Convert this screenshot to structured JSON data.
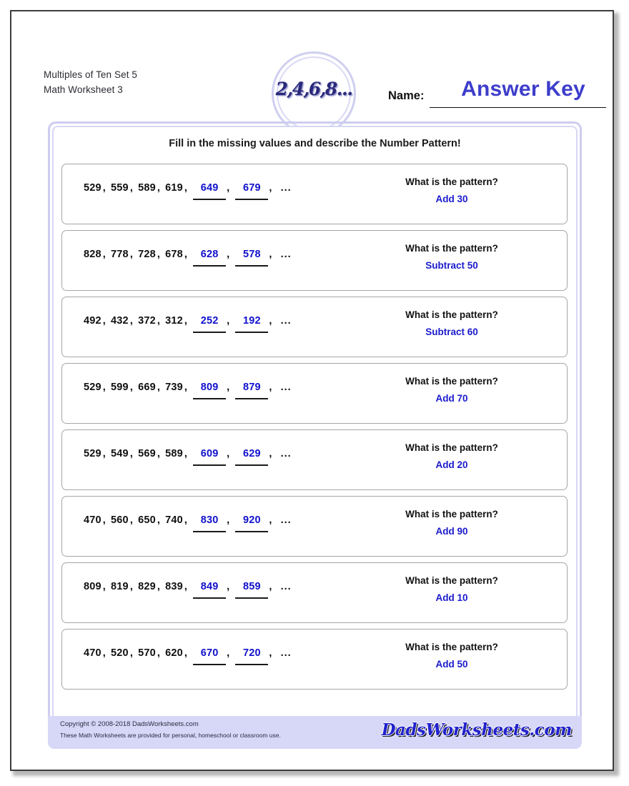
{
  "header": {
    "title_line1": "Multiples of Ten Set 5",
    "title_line2": "Math Worksheet 3",
    "logo_text": "2,4,6,8...",
    "name_label": "Name:",
    "answer_key": "Answer Key"
  },
  "instructions": "Fill in the missing values and describe the Number Pattern!",
  "question_label": "What is the pattern?",
  "ellipsis": "...",
  "colors": {
    "answer_blue": "#1111cc",
    "answer_key_blue": "#3d3dcc",
    "frame_lavender": "#cdcdf0",
    "footer_bg": "#d7d7f7",
    "box_border": "#a6a6a6"
  },
  "problems": [
    {
      "given": [
        "529",
        "559",
        "589",
        "619"
      ],
      "blanks": [
        "649",
        "679"
      ],
      "pattern": "Add 30"
    },
    {
      "given": [
        "828",
        "778",
        "728",
        "678"
      ],
      "blanks": [
        "628",
        "578"
      ],
      "pattern": "Subtract 50"
    },
    {
      "given": [
        "492",
        "432",
        "372",
        "312"
      ],
      "blanks": [
        "252",
        "192"
      ],
      "pattern": "Subtract 60"
    },
    {
      "given": [
        "529",
        "599",
        "669",
        "739"
      ],
      "blanks": [
        "809",
        "879"
      ],
      "pattern": "Add 70"
    },
    {
      "given": [
        "529",
        "549",
        "569",
        "589"
      ],
      "blanks": [
        "609",
        "629"
      ],
      "pattern": "Add 20"
    },
    {
      "given": [
        "470",
        "560",
        "650",
        "740"
      ],
      "blanks": [
        "830",
        "920"
      ],
      "pattern": "Add 90"
    },
    {
      "given": [
        "809",
        "819",
        "829",
        "839"
      ],
      "blanks": [
        "849",
        "859"
      ],
      "pattern": "Add 10"
    },
    {
      "given": [
        "470",
        "520",
        "570",
        "620"
      ],
      "blanks": [
        "670",
        "720"
      ],
      "pattern": "Add 50"
    }
  ],
  "footer": {
    "copyright": "Copyright © 2008-2018 DadsWorksheets.com",
    "notice": "These Math Worksheets are provided for personal, homeschool or classroom use.",
    "logo": "DadsWorksheets.com"
  }
}
